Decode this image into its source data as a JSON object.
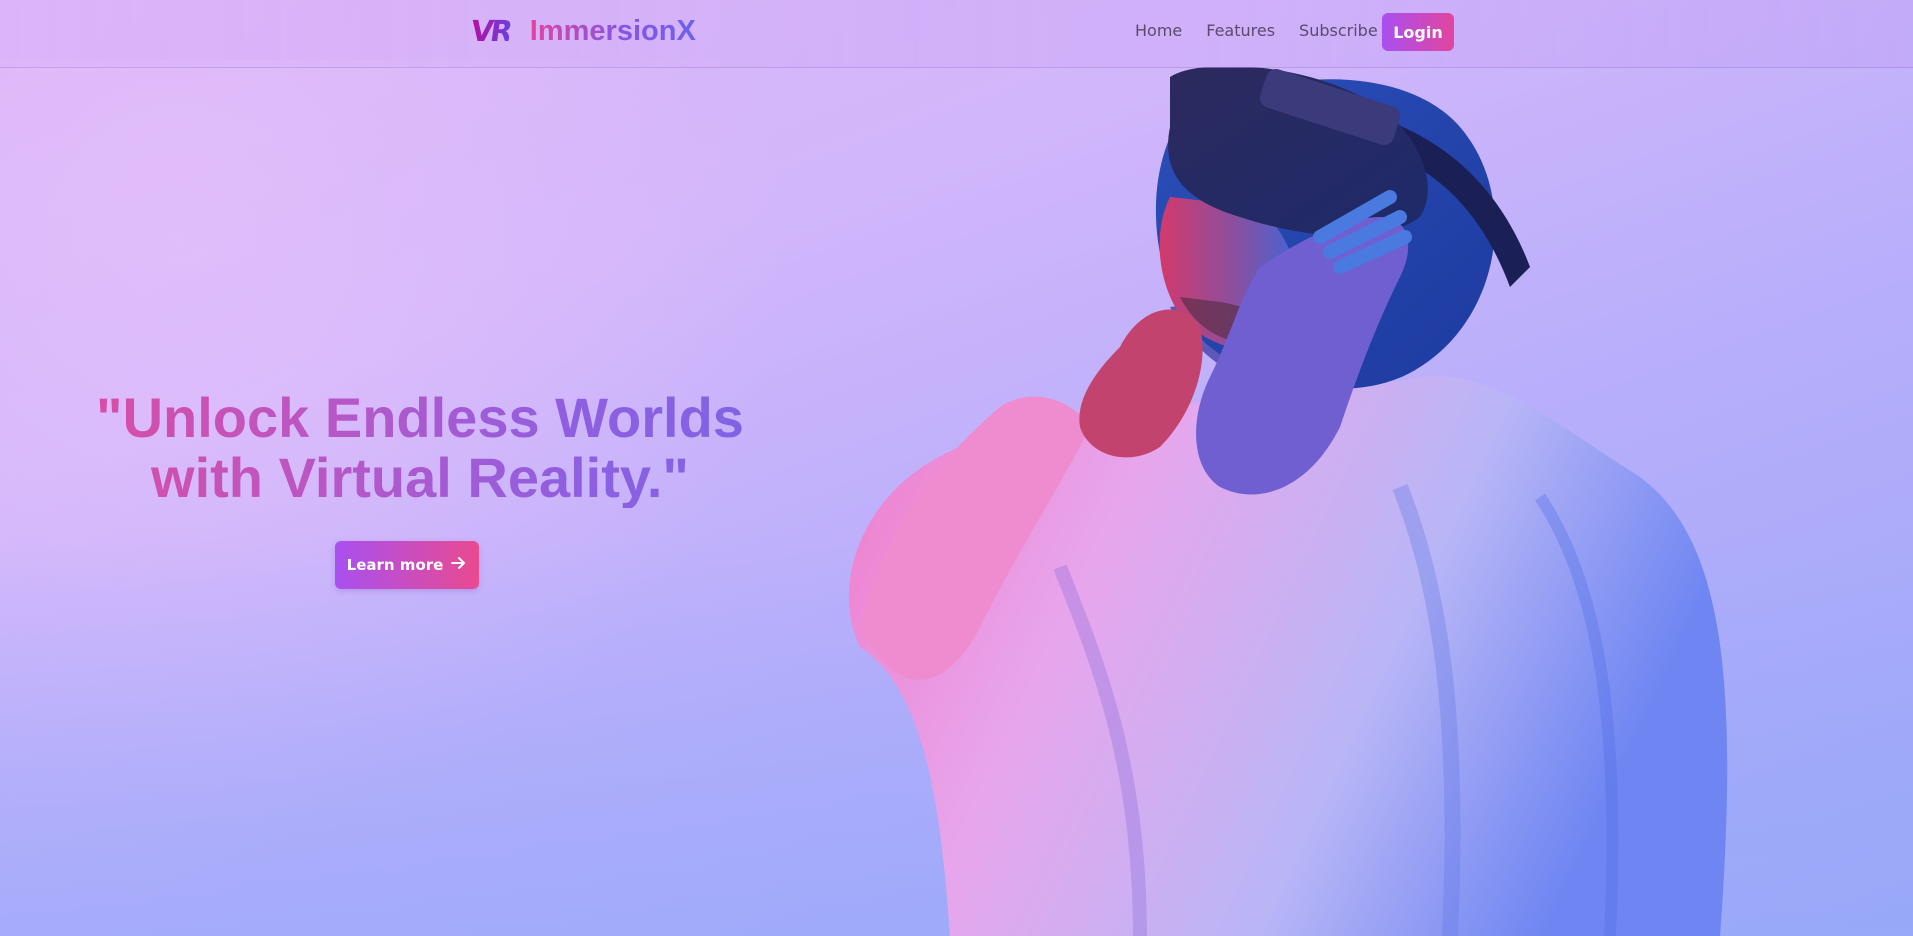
{
  "navbar": {
    "logo_mark": "VR",
    "brand": "ImmersionX",
    "links": [
      "Home",
      "Features",
      "Subscribe"
    ],
    "login_label": "Login"
  },
  "hero": {
    "title_line1": "\"Unlock Endless Worlds",
    "title_line2": "with Virtual Reality.\"",
    "cta_label": "Learn more",
    "cta_icon": "arrow-right-icon",
    "image_subject": "person wearing VR headset in white hoodie"
  },
  "colors": {
    "accent_pink": "#e2459f",
    "accent_purple": "#a94ff0",
    "nav_text": "#5b4a6e"
  }
}
